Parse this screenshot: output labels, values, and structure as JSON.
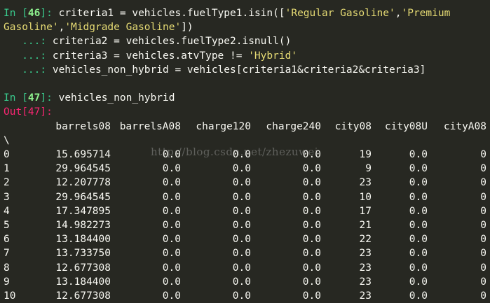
{
  "cells": {
    "in46": {
      "prompt_prefix": "In [",
      "number": "46",
      "prompt_suffix": "]: ",
      "line1_code_a": "criteria1 = vehicles.fuelType1.isin([",
      "line1_str1": "'Regular Gasoline'",
      "line1_comma": ",",
      "line1_str2_part": "'Premium",
      "line2_str2_rest": "Gasoline'",
      "line2_comma": ",",
      "line2_str3": "'Midgrade Gasoline'",
      "line2_end": "])",
      "cont_prompt": "   ...: ",
      "line3_code": "criteria2 = vehicles.fuelType2.isnull()",
      "line4_code_a": "criteria3 = vehicles.atvType != ",
      "line4_str": "'Hybrid'",
      "line5_code": "vehicles_non_hybrid = vehicles[criteria1&criteria2&criteria3]"
    },
    "in47": {
      "prompt_prefix": "In [",
      "number": "47",
      "prompt_suffix": "]: ",
      "code": "vehicles_non_hybrid"
    },
    "out47": {
      "label": "Out[47]:"
    }
  },
  "dataframe": {
    "columns": [
      "barrels08",
      "barrelsA08",
      "charge120",
      "charge240",
      "city08",
      "city08U",
      "cityA08"
    ],
    "continuation": "\\",
    "rows": [
      {
        "idx": "0",
        "vals": [
          "15.695714",
          "0.0",
          "0.0",
          "0.0",
          "19",
          "0.0",
          "0"
        ]
      },
      {
        "idx": "1",
        "vals": [
          "29.964545",
          "0.0",
          "0.0",
          "0.0",
          "9",
          "0.0",
          "0"
        ]
      },
      {
        "idx": "2",
        "vals": [
          "12.207778",
          "0.0",
          "0.0",
          "0.0",
          "23",
          "0.0",
          "0"
        ]
      },
      {
        "idx": "3",
        "vals": [
          "29.964545",
          "0.0",
          "0.0",
          "0.0",
          "10",
          "0.0",
          "0"
        ]
      },
      {
        "idx": "4",
        "vals": [
          "17.347895",
          "0.0",
          "0.0",
          "0.0",
          "17",
          "0.0",
          "0"
        ]
      },
      {
        "idx": "5",
        "vals": [
          "14.982273",
          "0.0",
          "0.0",
          "0.0",
          "21",
          "0.0",
          "0"
        ]
      },
      {
        "idx": "6",
        "vals": [
          "13.184400",
          "0.0",
          "0.0",
          "0.0",
          "22",
          "0.0",
          "0"
        ]
      },
      {
        "idx": "7",
        "vals": [
          "13.733750",
          "0.0",
          "0.0",
          "0.0",
          "23",
          "0.0",
          "0"
        ]
      },
      {
        "idx": "8",
        "vals": [
          "12.677308",
          "0.0",
          "0.0",
          "0.0",
          "23",
          "0.0",
          "0"
        ]
      },
      {
        "idx": "9",
        "vals": [
          "13.184400",
          "0.0",
          "0.0",
          "0.0",
          "23",
          "0.0",
          "0"
        ]
      },
      {
        "idx": "10",
        "vals": [
          "12.677308",
          "0.0",
          "0.0",
          "0.0",
          "23",
          "0.0",
          "0"
        ]
      }
    ]
  },
  "watermark": "http://blog.csdn.net/zhezuwei",
  "colors": {
    "background": "#272822",
    "prompt_in": "#39c98c",
    "prompt_out": "#f92672",
    "string": "#e6db74",
    "text": "#f8f8f2"
  }
}
